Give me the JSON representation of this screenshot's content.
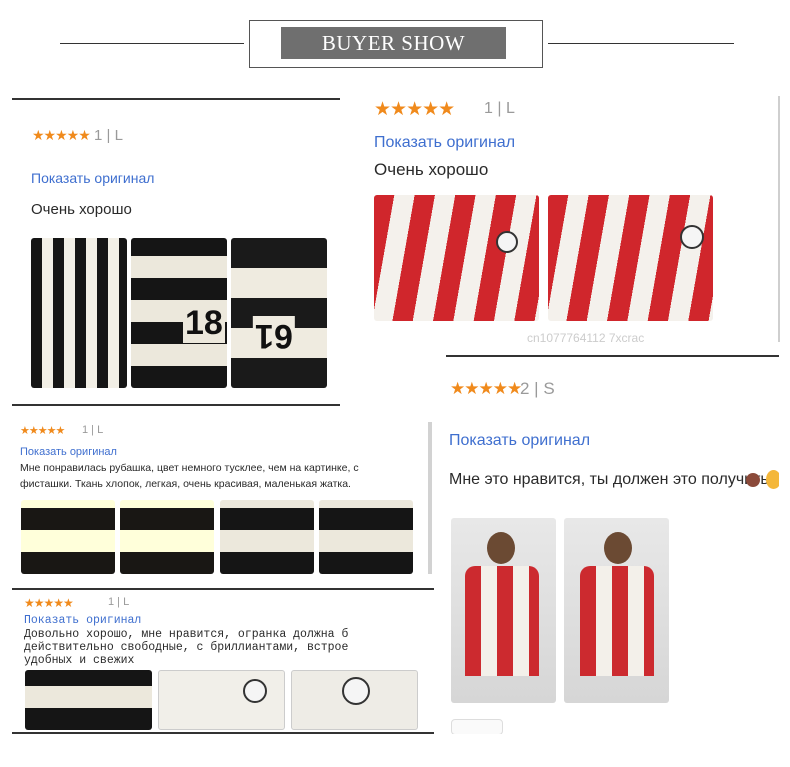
{
  "header": {
    "title": "BUYER SHOW",
    "watermark": "cn1077764112 7xcrac"
  },
  "reviews": [
    {
      "stars": "★★★★★",
      "meta": "1 | L",
      "original": "Показать оригинал",
      "text": "Очень хорошо",
      "photo_numbers": [
        "18",
        "61"
      ]
    },
    {
      "stars": "★★★★★",
      "meta": "1 | L",
      "original": "Показать оригинал",
      "text": "Очень хорошо",
      "watermark": "cn1077764112 7xcrac"
    },
    {
      "stars": "★★★★★",
      "meta": "2 | S",
      "original": "Показать оригинал",
      "text": "Мне это нравится, ты должен это получить"
    },
    {
      "stars": "★★★★★",
      "meta": "1 | L",
      "original": "Показать оригинал",
      "text_line1": "Мне понравилась рубашка, цвет немного тусклее, чем на картинке, с",
      "text_line2": "фисташки. Ткань хлопок, легкая, очень красивая, маленькая жатка."
    },
    {
      "stars": "★★★★★",
      "meta": "1 | L",
      "original": "Показать оригинал",
      "text_line1": "Довольно хорошо, мне нравится, огранка должна б",
      "text_line2": "действительно свободные, с бриллиантами, встрое",
      "text_line3": "удобных и свежих"
    }
  ],
  "colors": {
    "stars": "#f08a1c",
    "link": "#3f6fcf"
  }
}
